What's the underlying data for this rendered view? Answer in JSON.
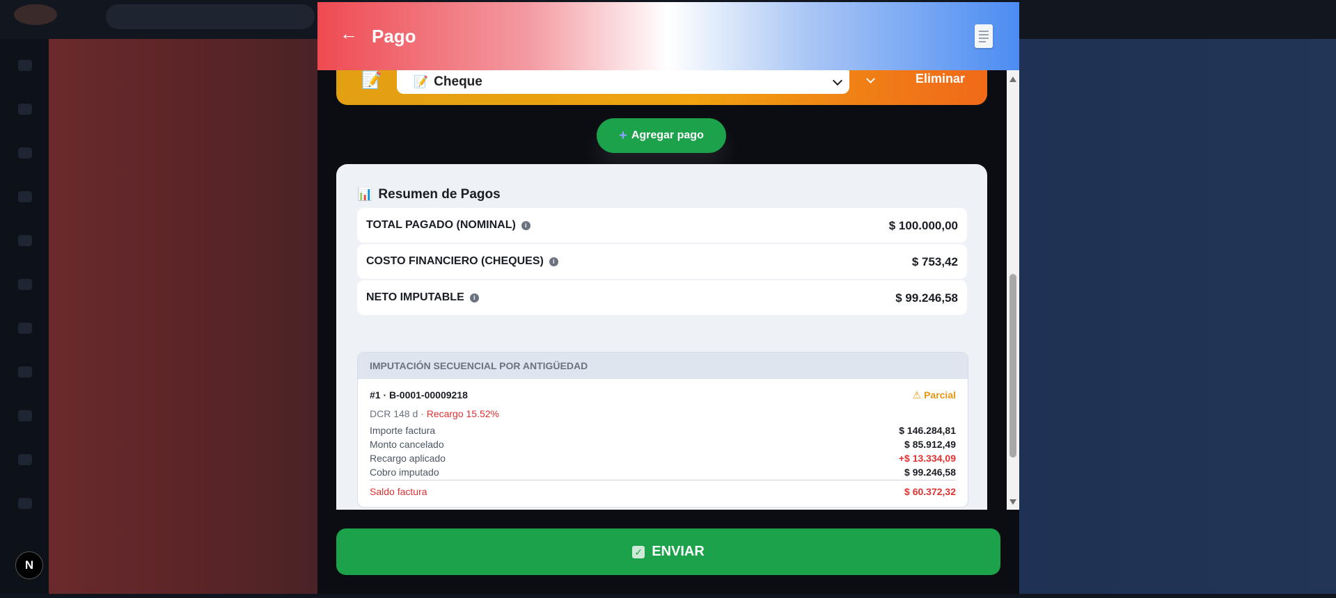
{
  "modal": {
    "title": "Pago",
    "back_icon": "←",
    "document_icon": "document-icon"
  },
  "payment_method": {
    "icon": "📝",
    "selected": "Cheque",
    "selected_icon": "📝",
    "delete_label": "Eliminar"
  },
  "add_payment": {
    "plus": "+",
    "label": "Agregar pago"
  },
  "summary": {
    "icon": "📊",
    "title": "Resumen de Pagos",
    "rows": [
      {
        "label": "TOTAL PAGADO (NOMINAL)",
        "value": "$ 100.000,00"
      },
      {
        "label": "COSTO FINANCIERO (CHEQUES)",
        "value": "$ 753,42"
      },
      {
        "label": "NETO IMPUTABLE",
        "value": "$ 99.246,58"
      }
    ],
    "info_glyph": "i"
  },
  "imputacion": {
    "header": "IMPUTACIÓN SECUENCIAL POR ANTIGÜEDAD",
    "invoice_id": "#1 · B-0001-00009218",
    "status": "⚠ Parcial",
    "meta_prefix": "DCR 148 d · ",
    "meta_recargo": "Recargo 15.52%",
    "details": [
      {
        "label": "Importe factura",
        "value": "$ 146.284,81"
      },
      {
        "label": "Monto cancelado",
        "value": "$ 85.912,49"
      },
      {
        "label": "Recargo aplicado",
        "value": "+$ 13.334,09"
      },
      {
        "label": "Cobro imputado",
        "value": "$ 99.246,58"
      }
    ],
    "saldo_label": "Saldo factura",
    "saldo_value": "$ 60.372,32"
  },
  "send": {
    "check": "✓",
    "label": "ENVIAR"
  },
  "nextjs_badge": "N",
  "colors": {
    "header_left": "#ef4a52",
    "header_right": "#4c8cf2",
    "payment_card": "#f0a20f",
    "success_green": "#1ba24a",
    "warning": "#e8950f",
    "danger": "#e03131"
  }
}
